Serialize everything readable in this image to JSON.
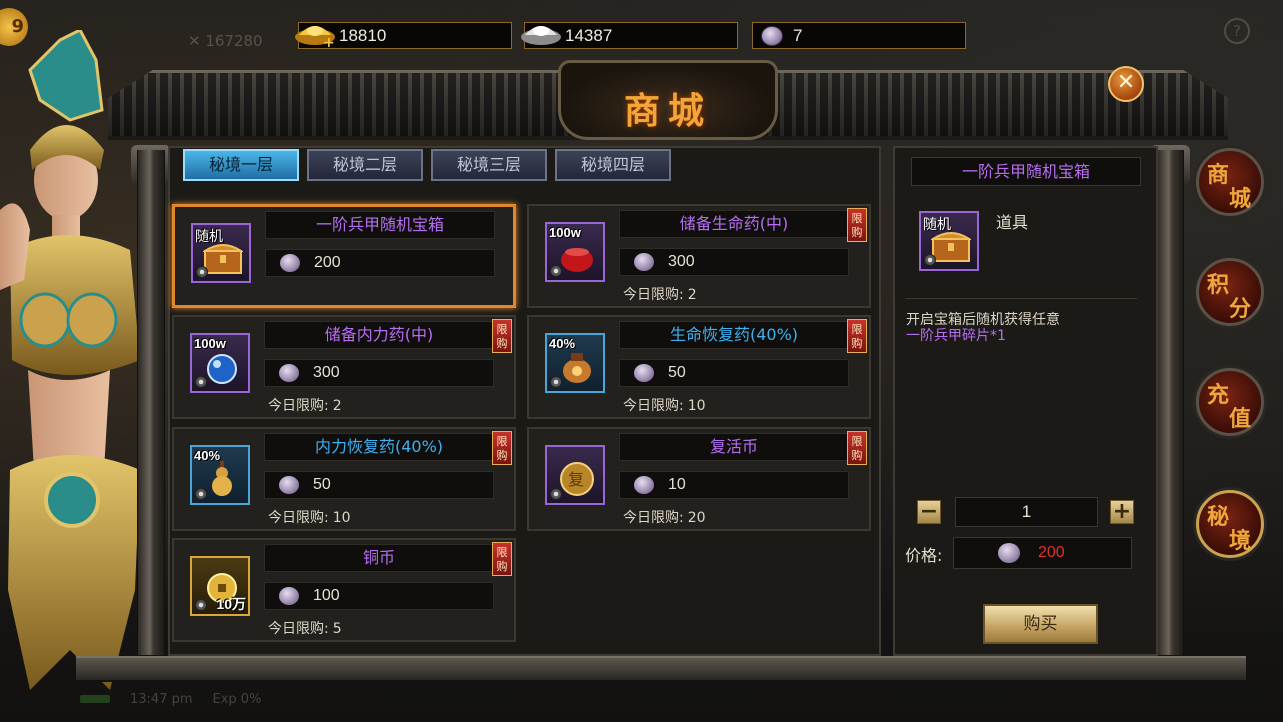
{
  "currency": {
    "gold": "18810",
    "silver": "14387",
    "jade": "7"
  },
  "shop_title": "商城",
  "tabs": [
    {
      "label": "秘境一层",
      "active": true
    },
    {
      "label": "秘境二层",
      "active": false
    },
    {
      "label": "秘境三层",
      "active": false
    },
    {
      "label": "秘境四层",
      "active": false
    }
  ],
  "items": [
    {
      "name": "一阶兵甲随机宝箱",
      "price": "200",
      "limit_label": "",
      "limit_value": "",
      "icon_tag": "随机",
      "icon": "treasure-chest-icon",
      "name_color": "purple",
      "badge": "",
      "selected": true
    },
    {
      "name": "储备生命药(中)",
      "price": "300",
      "limit_label": "今日限购:",
      "limit_value": "2",
      "icon_tag": "100w",
      "icon": "red-potion-icon",
      "name_color": "purple",
      "badge": "限购"
    },
    {
      "name": "储备内力药(中)",
      "price": "300",
      "limit_label": "今日限购:",
      "limit_value": "2",
      "icon_tag": "100w",
      "icon": "blue-potion-icon",
      "name_color": "purple",
      "badge": "限购"
    },
    {
      "name": "生命恢复药(40%)",
      "price": "50",
      "limit_label": "今日限购:",
      "limit_value": "10",
      "icon_tag": "40%",
      "icon": "health-jar-icon",
      "name_color": "blue",
      "badge": "限购"
    },
    {
      "name": "内力恢复药(40%)",
      "price": "50",
      "limit_label": "今日限购:",
      "limit_value": "10",
      "icon_tag": "40%",
      "icon": "mana-gourd-icon",
      "name_color": "blue",
      "badge": "限购"
    },
    {
      "name": "复活币",
      "price": "10",
      "limit_label": "今日限购:",
      "limit_value": "20",
      "icon_tag": "复",
      "icon": "revive-coin-icon",
      "name_color": "purple",
      "badge": "限购"
    },
    {
      "name": "铜币",
      "price": "100",
      "limit_label": "今日限购:",
      "limit_value": "5",
      "icon_tag": "10万",
      "icon": "copper-coin-icon",
      "name_color": "purple",
      "badge": "限购"
    }
  ],
  "detail": {
    "name": "一阶兵甲随机宝箱",
    "type": "道具",
    "icon_tag": "随机",
    "desc_line1": "开启宝箱后随机获得任意",
    "desc_line2": "一阶兵甲碎片*1",
    "quantity": "1",
    "price_label": "价格:",
    "price": "200",
    "buy_label": "购买",
    "minus": "−",
    "plus": "+"
  },
  "side_nav": [
    {
      "c1": "商",
      "c2": "城"
    },
    {
      "c1": "积",
      "c2": "分"
    },
    {
      "c1": "充",
      "c2": "值"
    },
    {
      "c1": "秘",
      "c2": "境"
    }
  ],
  "colors": {
    "purple_name": "#b66ef0",
    "blue_name": "#3fb0f0",
    "price_red": "#e0302a",
    "selected_border": "#e0892a",
    "title_gold": "#f2a637"
  }
}
